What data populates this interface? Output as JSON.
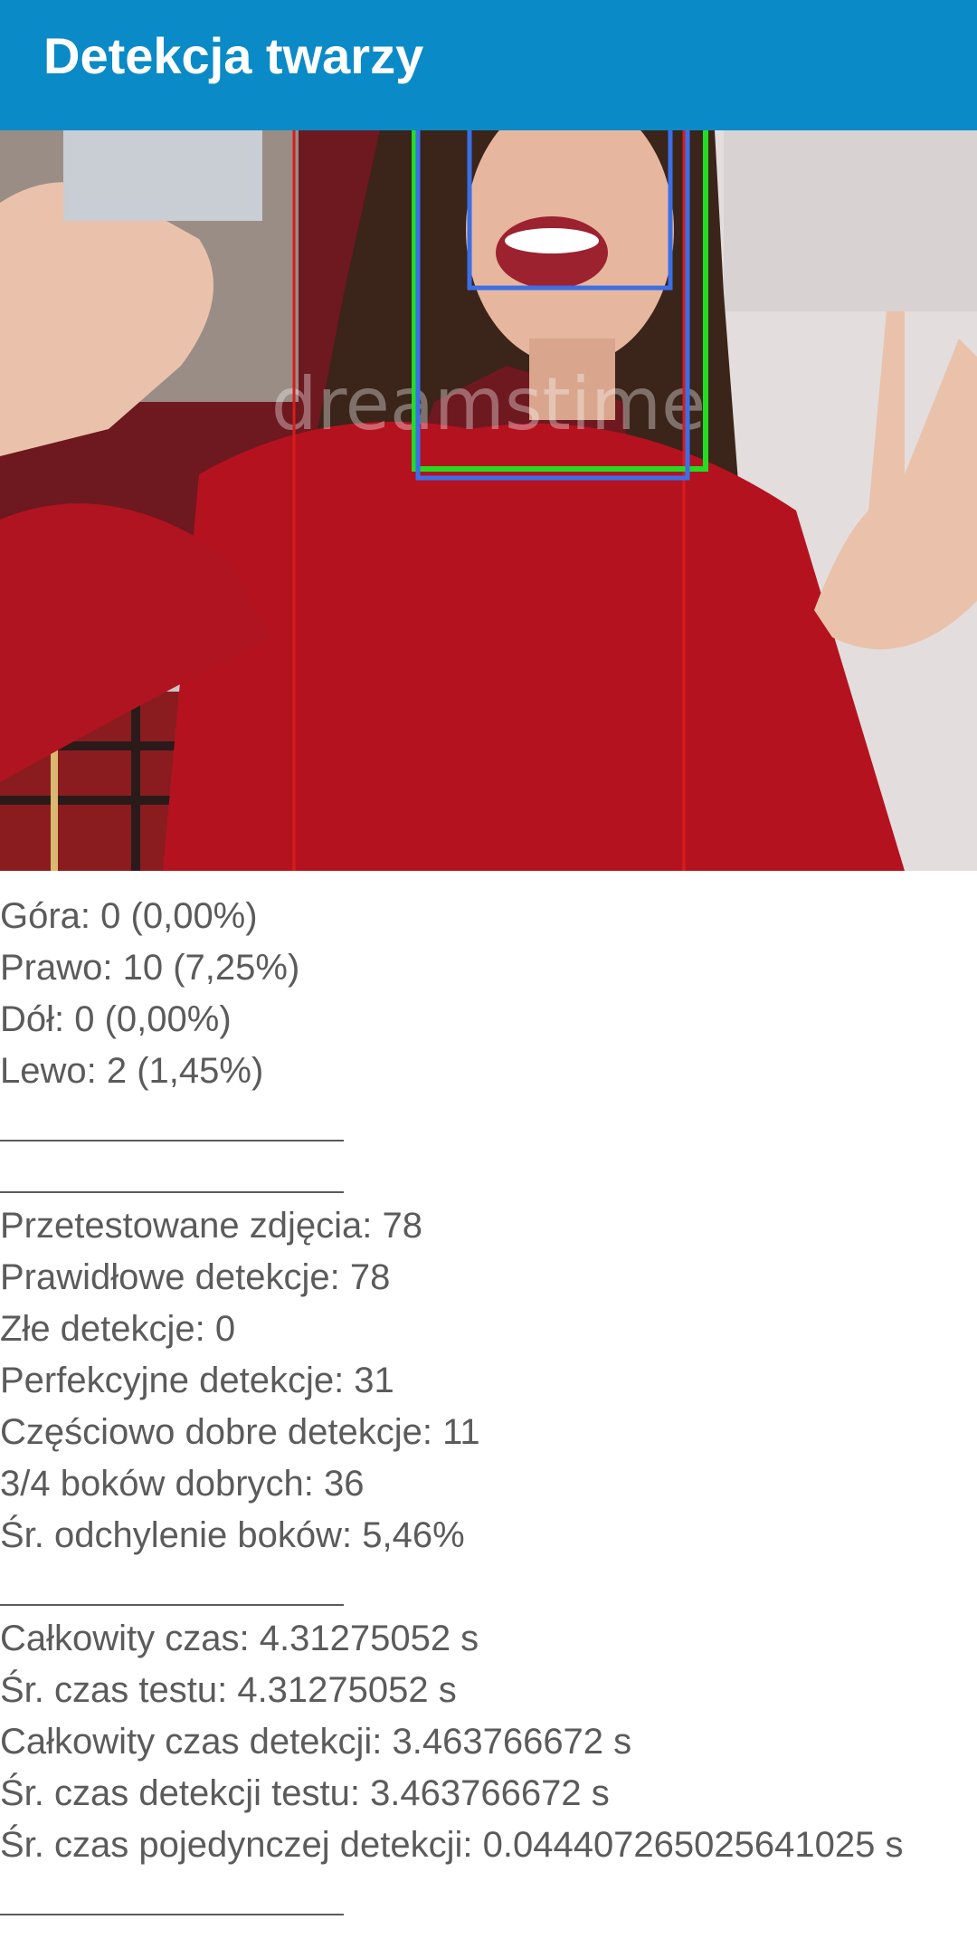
{
  "app_bar": {
    "title": "Detekcja twarzy"
  },
  "photo": {
    "watermark": "dreamstime"
  },
  "results": {
    "sides": [
      "Góra: 0 (0,00%)",
      "Prawo: 10 (7,25%)",
      "Dół: 0 (0,00%)",
      "Lewo: 2 (1,45%)"
    ],
    "stats": [
      "Przetestowane zdjęcia: 78",
      "Prawidłowe detekcje: 78",
      "Złe detekcje: 0",
      "Perfekcyjne detekcje: 31",
      "Częściowo dobre detekcje: 11",
      "3/4 boków dobrych: 36",
      "Śr. odchylenie boków: 5,46%"
    ],
    "timing": [
      "Całkowity czas: 4.31275052 s",
      "Śr. czas testu: 4.31275052 s",
      "Całkowity czas detekcji: 3.463766672 s",
      "Śr. czas detekcji testu: 3.463766672 s",
      "Śr. czas pojedynczej detekcji: 0.04440726502564102​5 s"
    ]
  },
  "colors": {
    "app_bar": "#0a8ac6",
    "text": "#5b5b5b",
    "box_green": "#22dd22",
    "box_blue": "#3b6fe8",
    "guide_red": "#d81c1c"
  }
}
